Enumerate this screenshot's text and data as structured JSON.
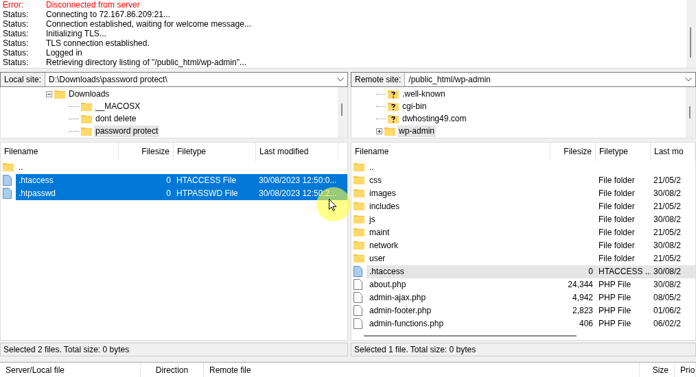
{
  "log": [
    {
      "kind": "error",
      "label": "Error:",
      "message": "Disconnected from server"
    },
    {
      "kind": "status",
      "label": "Status:",
      "message": "Connecting to 72.167.86.209:21..."
    },
    {
      "kind": "status",
      "label": "Status:",
      "message": "Connection established, waiting for welcome message..."
    },
    {
      "kind": "status",
      "label": "Status:",
      "message": "Initializing TLS..."
    },
    {
      "kind": "status",
      "label": "Status:",
      "message": "TLS connection established."
    },
    {
      "kind": "status",
      "label": "Status:",
      "message": "Logged in"
    },
    {
      "kind": "status",
      "label": "Status:",
      "message": "Retrieving directory listing of \"/public_html/wp-admin\"..."
    }
  ],
  "local": {
    "focused": true,
    "site_label": "Local site:",
    "path": "D:\\Downloads\\password protect\\",
    "tree": [
      {
        "name": "Downloads",
        "kind": "folder",
        "expanded": true,
        "selected": false,
        "children": [
          {
            "name": "__MACOSX",
            "kind": "folder",
            "selected": false
          },
          {
            "name": "dont delete",
            "kind": "folder",
            "selected": false
          },
          {
            "name": "password protect",
            "kind": "folder",
            "selected": true
          }
        ]
      }
    ],
    "columns": [
      "Filename",
      "Filesize",
      "Filetype",
      "Last modified"
    ],
    "rows": [
      {
        "kind": "folder",
        "name": "..",
        "selected": false
      },
      {
        "kind": "config",
        "name": ".htaccess",
        "size": "0",
        "type": "HTACCESS File",
        "modified": "30/08/2023 12:50:0...",
        "selected": true
      },
      {
        "kind": "config",
        "name": ".htpasswd",
        "size": "0",
        "type": "HTPASSWD File",
        "modified": "30/08/2023 12:50:2...",
        "selected": true
      }
    ],
    "status": "Selected 2 files. Total size: 0 bytes"
  },
  "remote": {
    "focused": false,
    "site_label": "Remote site:",
    "path": "/public_html/wp-admin",
    "tree": [
      {
        "name": ".well-known",
        "kind": "unknown",
        "selected": false
      },
      {
        "name": "cgi-bin",
        "kind": "unknown",
        "selected": false
      },
      {
        "name": "dwhosting49.com",
        "kind": "unknown",
        "selected": false
      },
      {
        "name": "wp-admin",
        "kind": "folder",
        "expanded": false,
        "selected": true
      }
    ],
    "columns": [
      "Filename",
      "Filesize",
      "Filetype",
      "Last mo"
    ],
    "rows": [
      {
        "kind": "folder",
        "name": "..",
        "selected": false
      },
      {
        "kind": "folder",
        "name": "css",
        "type": "File folder",
        "modified": "21/05/2",
        "selected": false
      },
      {
        "kind": "folder",
        "name": "images",
        "type": "File folder",
        "modified": "30/08/2",
        "selected": false
      },
      {
        "kind": "folder",
        "name": "includes",
        "type": "File folder",
        "modified": "21/05/2",
        "selected": false
      },
      {
        "kind": "folder",
        "name": "js",
        "type": "File folder",
        "modified": "30/08/2",
        "selected": false
      },
      {
        "kind": "folder",
        "name": "maint",
        "type": "File folder",
        "modified": "21/05/2",
        "selected": false
      },
      {
        "kind": "folder",
        "name": "network",
        "type": "File folder",
        "modified": "30/08/2",
        "selected": false
      },
      {
        "kind": "folder",
        "name": "user",
        "type": "File folder",
        "modified": "21/05/2",
        "selected": false
      },
      {
        "kind": "config",
        "name": ".htaccess",
        "size": "0",
        "type": "HTACCESS ...",
        "modified": "30/08/2",
        "selected": true
      },
      {
        "kind": "file",
        "name": "about.php",
        "size": "24,344",
        "type": "PHP File",
        "modified": "30/08/2",
        "selected": false
      },
      {
        "kind": "file",
        "name": "admin-ajax.php",
        "size": "4,942",
        "type": "PHP File",
        "modified": "08/05/2",
        "selected": false
      },
      {
        "kind": "file",
        "name": "admin-footer.php",
        "size": "2,823",
        "type": "PHP File",
        "modified": "01/06/2",
        "selected": false
      },
      {
        "kind": "file",
        "name": "admin-functions.php",
        "size": "406",
        "type": "PHP File",
        "modified": "06/02/2",
        "selected": false
      }
    ],
    "status": "Selected 1 file. Total size: 0 bytes"
  },
  "queue": {
    "columns": [
      "Server/Local file",
      "Direction",
      "Remote file",
      "Size",
      "Prio"
    ]
  }
}
